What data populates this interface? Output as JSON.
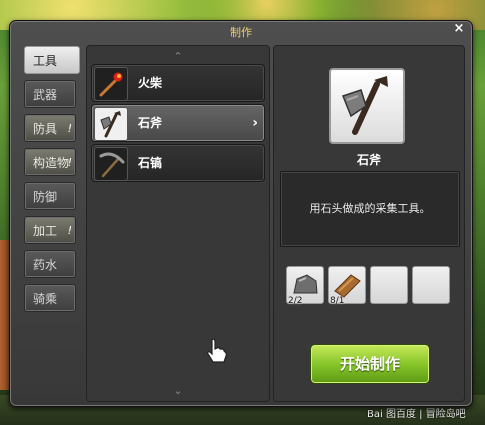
{
  "window": {
    "title": "制作",
    "close_label": "×"
  },
  "tabs": [
    {
      "label": "工具",
      "state": "active",
      "alert": ""
    },
    {
      "label": "武器",
      "state": "normal",
      "alert": ""
    },
    {
      "label": "防具",
      "state": "alert",
      "alert": "!"
    },
    {
      "label": "构造物",
      "state": "alert",
      "alert": "!"
    },
    {
      "label": "防御",
      "state": "normal",
      "alert": ""
    },
    {
      "label": "加工",
      "state": "alert",
      "alert": "!"
    },
    {
      "label": "药水",
      "state": "normal",
      "alert": ""
    },
    {
      "label": "骑乘",
      "state": "normal",
      "alert": ""
    }
  ],
  "recipe_list": {
    "scroll_up": "⌃",
    "scroll_down": "⌄",
    "items": [
      {
        "label": "火柴",
        "icon": "match-icon",
        "selected": false
      },
      {
        "label": "石斧",
        "icon": "stone-axe-icon",
        "selected": true,
        "chevron": "›"
      },
      {
        "label": "石镐",
        "icon": "stone-pickaxe-icon",
        "selected": false
      }
    ]
  },
  "detail": {
    "name": "石斧",
    "icon": "stone-axe-icon",
    "description": "用石头做成的采集工具。",
    "materials": [
      {
        "icon": "stone-icon",
        "count": "2/2"
      },
      {
        "icon": "wood-icon",
        "count": "8/1"
      },
      {
        "icon": "empty-slot",
        "count": ""
      },
      {
        "icon": "empty-slot",
        "count": ""
      }
    ],
    "craft_button": "开始制作"
  },
  "watermark": "Bai 图百度 | 冒险岛吧",
  "colors": {
    "title": "#f0d070",
    "craft_button": "#88c62a",
    "panel": "#383838"
  }
}
